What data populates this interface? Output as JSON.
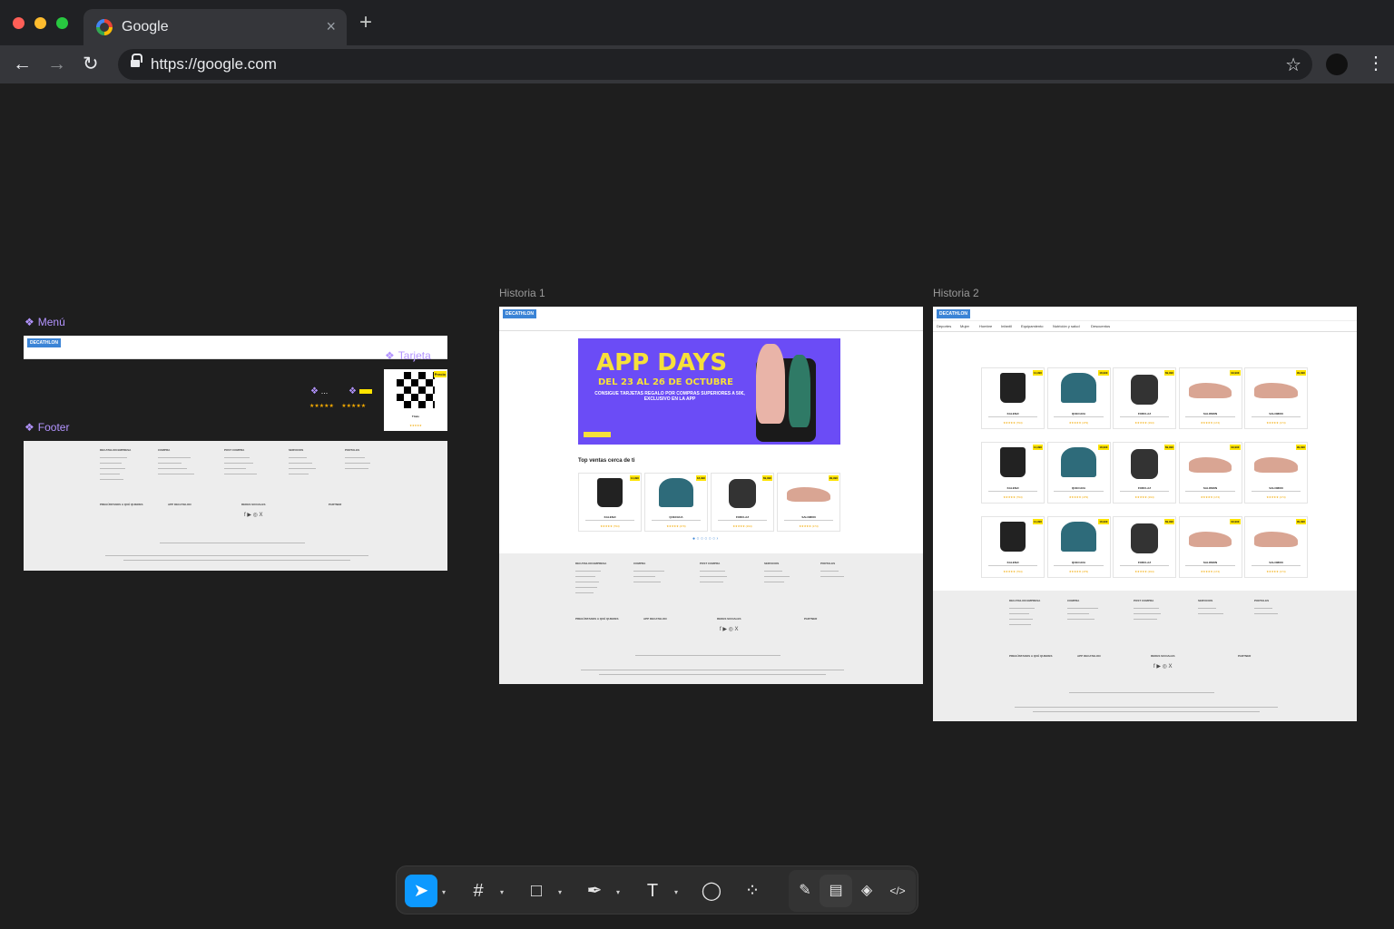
{
  "browser": {
    "tab_title": "Google",
    "tab_close": "×",
    "new_tab": "+",
    "url": "https://google.com",
    "back": "←",
    "forward": "→",
    "reload": "↻",
    "star": "☆",
    "menu": "⋮"
  },
  "canvas": {
    "components": {
      "menu_label": "Menú",
      "tarjeta_label": "Tarjeta",
      "footer_label": "Footer",
      "component_icon": "❖",
      "card_preview": {
        "badge": "Precio",
        "name": "Título",
        "dots": "..."
      }
    },
    "frames": {
      "historia1_label": "Historia 1",
      "historia2_label": "Historia 2"
    },
    "site": {
      "logo": "DECATHLON",
      "banner_title": "APP DAYS",
      "banner_dates": "DEL 23 AL 26 DE OCTUBRE",
      "banner_sub": "CONSIGUE TARJETAS REGALO POR COMPRAS SUPERIORES A 50€, EXCLUSIVO EN LA APP",
      "top_ventas": "Top ventas cerca de ti",
      "subnav": [
        "Deportes",
        "Mujer",
        "Hombre",
        "Infantil",
        "Equipamiento",
        "Nutrición y salud",
        "Descuentos"
      ],
      "footer_cols": [
        "DECATHLON EMPRESA",
        "COMPRA",
        "POST COMPRA",
        "SERVICIOS",
        "PORTALES"
      ],
      "footer_cols2": [
        "PREGÚNTANOS A QUÉ QUIERES",
        "APP DECATHLON",
        "REDES SOCIALES",
        "PARTNER"
      ],
      "products": [
        {
          "name": "KALENJI",
          "price": "14,99€",
          "stars": "★★★★★ (794)",
          "kind": "pants"
        },
        {
          "name": "QUECHUA",
          "price": "18,99€",
          "stars": "★★★★★ (479)",
          "kind": "jacket"
        },
        {
          "name": "FORCLAZ",
          "price": "69,99€",
          "stars": "★★★★★ (194)",
          "kind": "bag"
        },
        {
          "name": "SALOMON",
          "price": "99,99€",
          "stars": "★★★★★ (174)",
          "kind": "shoe"
        },
        {
          "name": "SALOMON",
          "price": "99,99€",
          "stars": "★★★★★ (174)",
          "kind": "shoe"
        }
      ]
    }
  },
  "tools": {
    "move": "➤",
    "frame": "#",
    "shape": "□",
    "pen": "✒",
    "text": "T",
    "comment": "◯",
    "actions": "⁘",
    "draw": "✎",
    "dev": "</>",
    "caret": "▾"
  },
  "colors": {
    "accent": "#0d99ff",
    "component": "#b394ff",
    "banner": "#6b4cf6",
    "price_tag": "#ffe400"
  }
}
